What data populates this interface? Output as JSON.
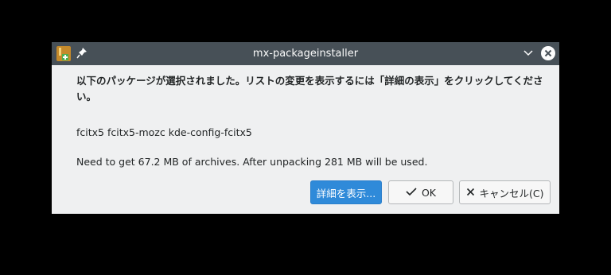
{
  "window": {
    "title": "mx-packageinstaller",
    "icons": {
      "app": "package-download-icon",
      "pin": "pin-icon",
      "minimize": "chevron-down-icon",
      "close": "close-icon"
    }
  },
  "dialog": {
    "message": "以下のパッケージが選択されました。リストの変更を表示するには「詳細の表示」をクリックしてください。",
    "packages": "fcitx5 fcitx5-mozc kde-config-fcitx5",
    "size_info": "Need to get 67.2 MB of archives. After unpacking 281 MB will be used."
  },
  "buttons": {
    "details_label": "詳細を表示...",
    "ok_label": "OK",
    "cancel_label": "キャンセル(C)",
    "ok_icon": "checkmark-icon",
    "cancel_icon": "x-icon"
  },
  "colors": {
    "titlebar": "#475057",
    "window_bg": "#eff0f1",
    "accent": "#2f8ad9",
    "text": "#232627"
  }
}
